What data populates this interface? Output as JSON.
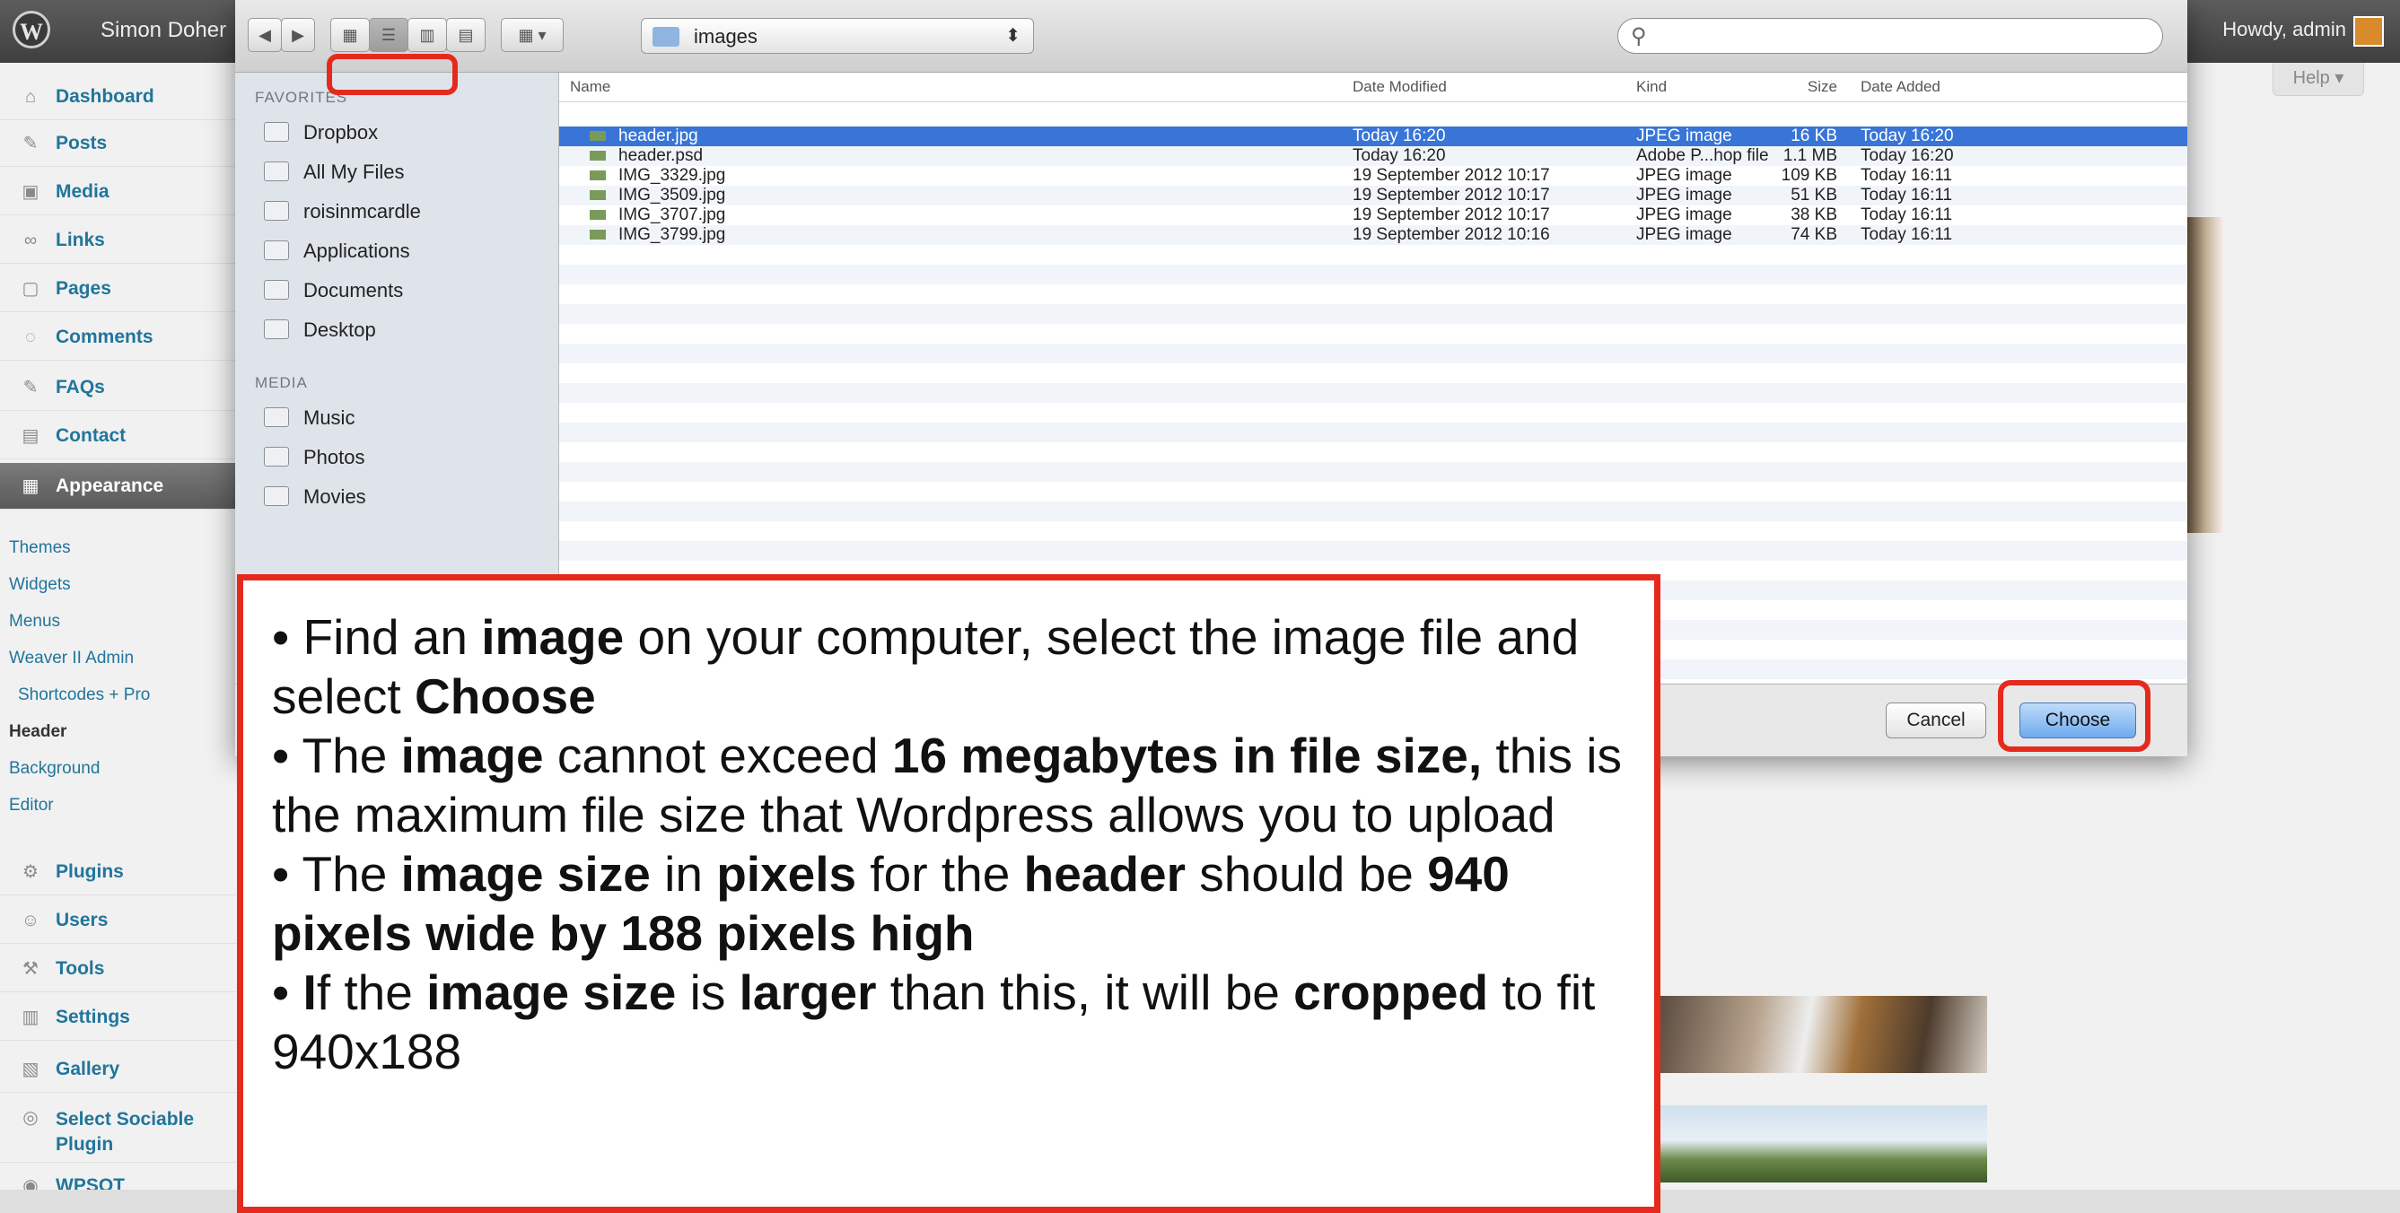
{
  "admin_bar": {
    "site_name": "Simon Doher",
    "howdy": "Howdy, admin",
    "help": "Help ▾"
  },
  "sidebar": {
    "menu": [
      {
        "label": "Dashboard",
        "icon": "dashboard-icon"
      },
      {
        "label": "Posts",
        "icon": "pin-icon"
      },
      {
        "label": "Media",
        "icon": "media-icon"
      },
      {
        "label": "Links",
        "icon": "link-icon"
      },
      {
        "label": "Pages",
        "icon": "page-icon"
      },
      {
        "label": "Comments",
        "icon": "comment-icon"
      },
      {
        "label": "FAQs",
        "icon": "pin-icon"
      },
      {
        "label": "Contact",
        "icon": "contact-icon"
      },
      {
        "label": "Appearance",
        "icon": "appearance-icon",
        "current": true
      }
    ],
    "appearance_sub": [
      "Themes",
      "Widgets",
      "Menus",
      "Weaver II Admin",
      "Shortcodes + Pro",
      "Header",
      "Background",
      "Editor"
    ],
    "active_sub": "Header",
    "menu_lower": [
      {
        "label": "Plugins",
        "icon": "plugin-icon"
      },
      {
        "label": "Users",
        "icon": "users-icon"
      },
      {
        "label": "Tools",
        "icon": "tools-icon"
      },
      {
        "label": "Settings",
        "icon": "settings-icon"
      },
      {
        "label": "Gallery",
        "icon": "gallery-icon"
      },
      {
        "label": "Select Sociable Plugin",
        "icon": "sociable-icon"
      },
      {
        "label": "WPSOT",
        "icon": "wpsot-icon"
      }
    ]
  },
  "dialog": {
    "path": "images",
    "search_placeholder": "",
    "favorites_heading": "FAVORITES",
    "favorites": [
      "Dropbox",
      "All My Files",
      "roisinmcardle",
      "Applications",
      "Documents",
      "Desktop"
    ],
    "media_heading": "MEDIA",
    "media": [
      "Music",
      "Photos",
      "Movies"
    ],
    "columns": [
      "Name",
      "Date Modified",
      "Size",
      "Kind",
      "Date Added"
    ],
    "files": [
      {
        "name": "header.jpg",
        "modified": "Today 16:20",
        "size": "16 KB",
        "kind": "JPEG image",
        "added": "Today 16:20",
        "selected": true
      },
      {
        "name": "header.psd",
        "modified": "Today 16:20",
        "size": "1.1 MB",
        "kind": "Adobe P...hop file",
        "added": "Today 16:20"
      },
      {
        "name": "IMG_3329.jpg",
        "modified": "19 September 2012 10:17",
        "size": "109 KB",
        "kind": "JPEG image",
        "added": "Today 16:11"
      },
      {
        "name": "IMG_3509.jpg",
        "modified": "19 September 2012 10:17",
        "size": "51 KB",
        "kind": "JPEG image",
        "added": "Today 16:11"
      },
      {
        "name": "IMG_3707.jpg",
        "modified": "19 September 2012 10:17",
        "size": "38 KB",
        "kind": "JPEG image",
        "added": "Today 16:11"
      },
      {
        "name": "IMG_3799.jpg",
        "modified": "19 September 2012 10:16",
        "size": "74 KB",
        "kind": "JPEG image",
        "added": "Today 16:11"
      }
    ],
    "cancel_label": "Cancel",
    "choose_label": "Choose"
  },
  "callout": {
    "paragraphs": [
      [
        {
          "t": "• Find an ",
          "b": false
        },
        {
          "t": "image",
          "b": true
        },
        {
          "t": " on your computer, select the image file and select ",
          "b": false
        },
        {
          "t": "Choose",
          "b": true
        }
      ],
      [
        {
          "t": "• The ",
          "b": false
        },
        {
          "t": "image",
          "b": true
        },
        {
          "t": " cannot exceed ",
          "b": false
        },
        {
          "t": "16 megabytes in file size,",
          "b": true
        },
        {
          "t": " this is the maximum file size that Wordpress allows you to upload",
          "b": false
        }
      ],
      [
        {
          "t": "• The ",
          "b": false
        },
        {
          "t": "image size",
          "b": true
        },
        {
          "t": " in ",
          "b": false
        },
        {
          "t": "pixels",
          "b": true
        },
        {
          "t": " for the ",
          "b": false
        },
        {
          "t": "header",
          "b": true
        },
        {
          "t": " should be ",
          "b": false
        },
        {
          "t": "940 pixels wide by 188 pixels high",
          "b": true
        }
      ],
      [
        {
          "t": "• ",
          "b": false
        },
        {
          "t": "I",
          "b": true
        },
        {
          "t": "f the ",
          "b": false
        },
        {
          "t": "image size",
          "b": true
        },
        {
          "t": " is ",
          "b": false
        },
        {
          "t": "larger",
          "b": true
        },
        {
          "t": " than this, it will be ",
          "b": false
        },
        {
          "t": "cropped",
          "b": true
        },
        {
          "t": " to fit 940x188",
          "b": false
        }
      ]
    ]
  },
  "colors": {
    "highlight": "#e52a1d",
    "selection": "#3875d7",
    "wp_link": "#21759b"
  }
}
